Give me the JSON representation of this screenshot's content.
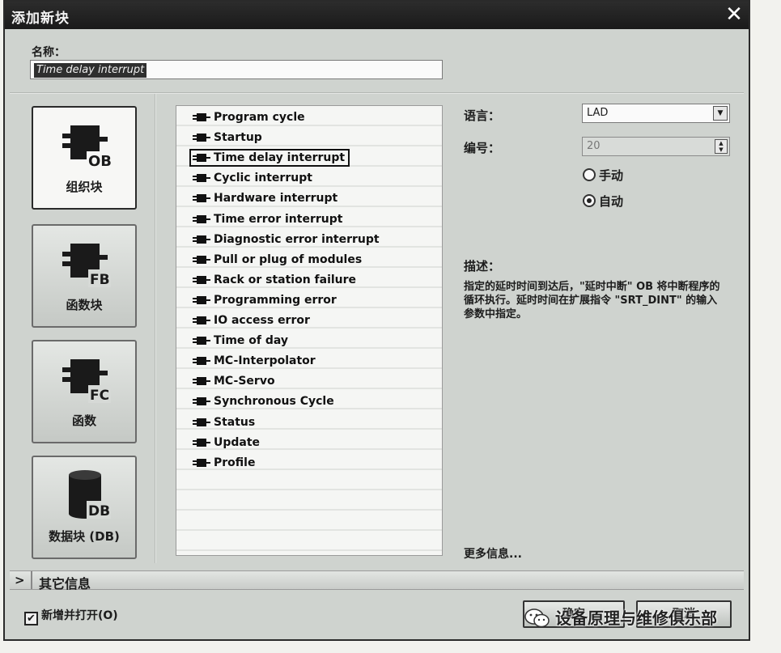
{
  "dialog": {
    "title": "添加新块",
    "close_glyph": "✕"
  },
  "name": {
    "label": "名称：",
    "value": "Time delay interrupt"
  },
  "block_types": [
    {
      "label": "组织块",
      "icon_text": "OB",
      "icon": "ob-block-icon"
    },
    {
      "label": "函数块",
      "icon_text": "FB",
      "icon": "fb-block-icon"
    },
    {
      "label": "函数",
      "icon_text": "FC",
      "icon": "fc-block-icon"
    },
    {
      "label": "数据块 (DB)",
      "icon_text": "DB",
      "icon": "db-cylinder-icon"
    }
  ],
  "ob_list": [
    "Program cycle",
    "Startup",
    "Time delay interrupt",
    "Cyclic interrupt",
    "Hardware interrupt",
    "Time error interrupt",
    "Diagnostic error interrupt",
    "Pull or plug of modules",
    "Rack or station failure",
    "Programming error",
    "IO access error",
    "Time of day",
    "MC-Interpolator",
    "MC-Servo",
    "Synchronous Cycle",
    "Status",
    "Update",
    "Profile"
  ],
  "selected_ob": "Time delay interrupt",
  "properties": {
    "language_label": "语言：",
    "language_value": "LAD",
    "number_label": "编号：",
    "number_value": "20",
    "manual_label": "手动",
    "auto_label": "自动",
    "numbering_mode": "自动"
  },
  "description": {
    "label": "描述：",
    "text": "指定的延时时间到达后，\"延时中断\" OB 将中断程序的循环执行。延时时间在扩展指令 \"SRT_DINT\" 的输入参数中指定。"
  },
  "more_info_link": "更多信息...",
  "additional_info": {
    "chevron": ">",
    "label": "其它信息"
  },
  "footer": {
    "add_open_label": "新增并打开(O)",
    "add_open_checked": true,
    "ok_label": "确定",
    "cancel_label": "取消"
  },
  "watermark": "设备原理与维修俱乐部"
}
